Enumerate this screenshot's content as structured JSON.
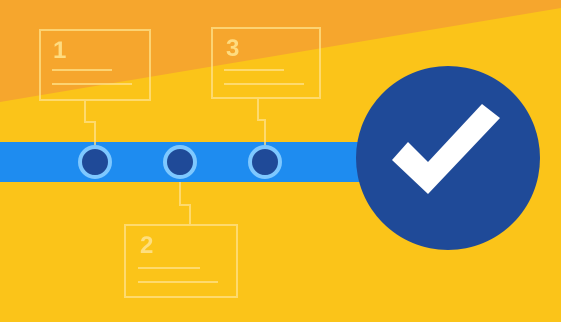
{
  "colors": {
    "background_primary": "#fbc419",
    "background_secondary": "#f6a62d",
    "track": "#1e8cf0",
    "node_fill": "#1f4a98",
    "node_ring": "#7ec8ff",
    "card_outline": "#ffe28a",
    "check_circle": "#1f4a98",
    "check_mark": "#ffffff"
  },
  "steps": [
    {
      "number": "1"
    },
    {
      "number": "3"
    },
    {
      "number": "2"
    }
  ],
  "icons": {
    "check": "check-icon"
  }
}
